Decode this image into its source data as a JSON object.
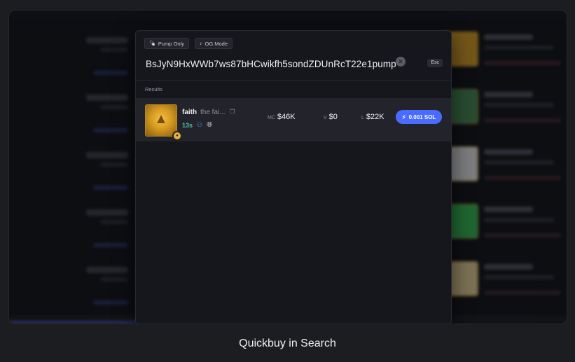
{
  "modal": {
    "filters": [
      {
        "label": "Pump Only",
        "icon": "pill-icon"
      },
      {
        "label": "OG Mode",
        "icon": "bell-icon"
      }
    ],
    "search": {
      "value": "BsJyN9HxWWb7ws87bHCwikfh5sondZDUnRcT22e1pump",
      "clear_icon": "clear-icon",
      "esc_label": "Esc"
    },
    "results_label": "Results",
    "results": [
      {
        "name": "faith",
        "subname": "the fai...",
        "age": "13s",
        "mc_label": "MC",
        "mc_value": "$46K",
        "v_label": "V",
        "v_value": "$0",
        "l_label": "L",
        "l_value": "$22K",
        "buy_label": "0.001 SOL",
        "buy_icon": "lightning-icon",
        "accent": "#4a6bff"
      }
    ]
  },
  "caption": "Quickbuy in Search"
}
